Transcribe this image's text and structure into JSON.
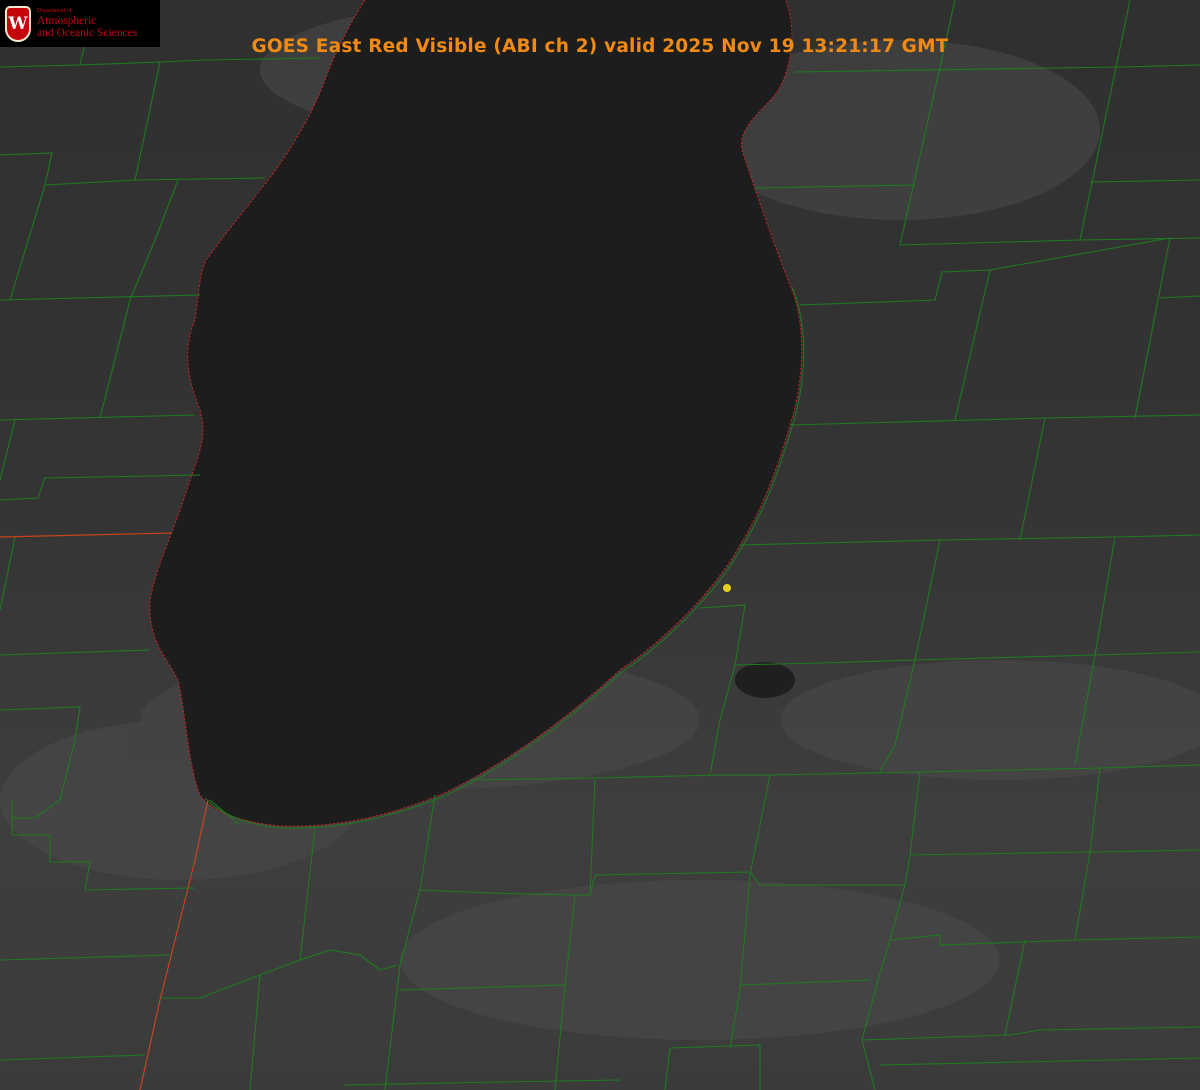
{
  "header": {
    "title": "GOES East Red Visible (ABI ch 2) valid 2025 Nov 19 13:21:17 GMT"
  },
  "logo": {
    "department_line": "Department of",
    "line1": "Atmospheric",
    "line2": "and Oceanic Sciences",
    "seal_letter": "W"
  },
  "map": {
    "satellite": "GOES East",
    "channel": "Red Visible (ABI ch 2)",
    "valid_time": "2025 Nov 19 13:21:17 GMT",
    "colors": {
      "county_lines": "#1f7a1f",
      "state_lines": "#c8451a",
      "coastline": "#d42020",
      "point_marker": "#e6d21e",
      "title_text": "#f08a12",
      "lake": "#1d1d1d",
      "land": "#3a3a3a"
    },
    "marker": {
      "icon": "yellow-dot-icon"
    }
  }
}
